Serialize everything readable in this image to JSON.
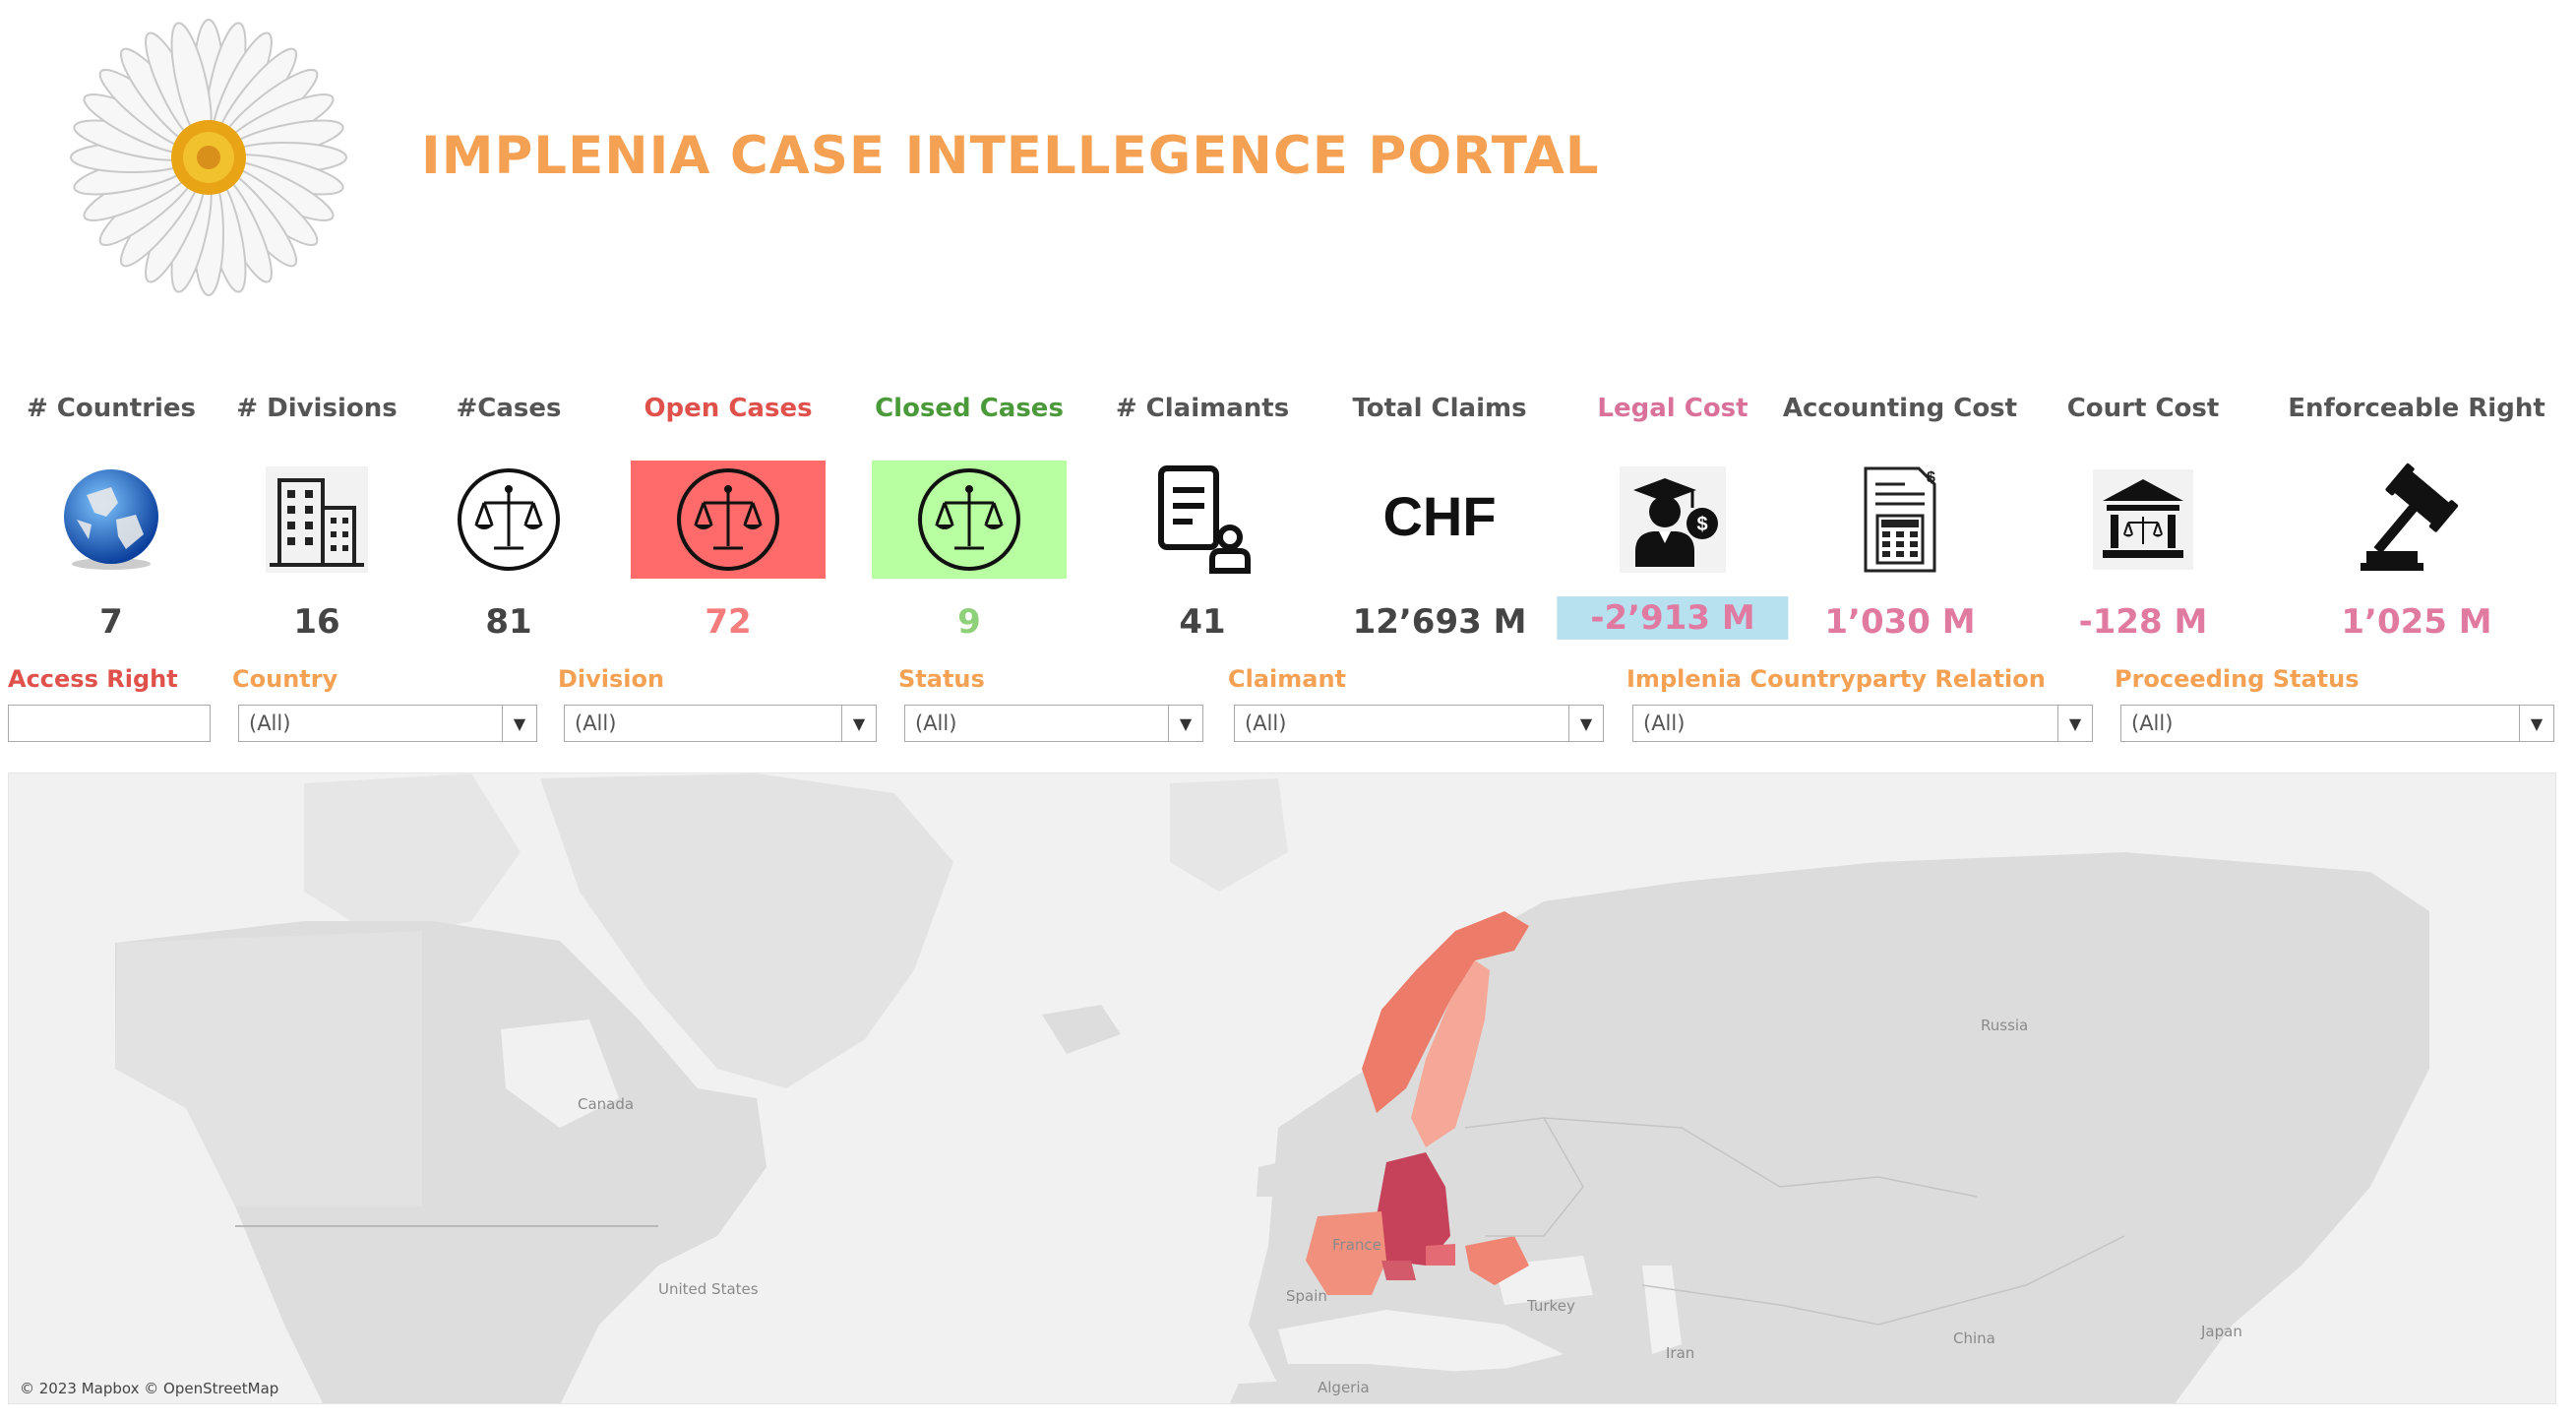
{
  "header": {
    "title": "IMPLENIA CASE INTELLEGENCE PORTAL",
    "logo_icon": "daisy-flower-icon"
  },
  "kpis": [
    {
      "label": "# Countries",
      "value": "7",
      "icon": "globe-icon",
      "label_color": "#555555",
      "value_color": "#444444"
    },
    {
      "label": "# Divisions",
      "value": "16",
      "icon": "building-icon",
      "label_color": "#555555",
      "value_color": "#444444"
    },
    {
      "label": "#Cases",
      "value": "81",
      "icon": "scales-icon",
      "label_color": "#555555",
      "value_color": "#444444"
    },
    {
      "label": "Open Cases",
      "value": "72",
      "icon": "scales-icon",
      "label_color": "#e0514b",
      "value_color": "#f47c7c",
      "background": "#ff6b6b"
    },
    {
      "label": "Closed Cases",
      "value": "9",
      "icon": "scales-icon",
      "label_color": "#4a9a3a",
      "value_color": "#8fd17a",
      "background": "#b7ffa0"
    },
    {
      "label": "# Claimants",
      "value": "41",
      "icon": "document-user-icon",
      "label_color": "#555555",
      "value_color": "#444444"
    },
    {
      "label": "Total Claims",
      "value": "12’693 M",
      "icon_text": "CHF",
      "icon": "chf-currency-icon",
      "label_color": "#555555",
      "value_color": "#444444"
    },
    {
      "label": "Legal Cost",
      "value": "-2’913 M",
      "icon": "lawyer-graduate-icon",
      "label_color": "#d9719a",
      "value_color": "#e07aa0",
      "value_background": "#b8e1f0"
    },
    {
      "label": "Accounting Cost",
      "value": "1’030 M",
      "icon": "invoice-calculator-icon",
      "label_color": "#555555",
      "value_color": "#e07aa0"
    },
    {
      "label": "Court Cost",
      "value": "-128 M",
      "icon": "courthouse-icon",
      "label_color": "#555555",
      "value_color": "#e07aa0"
    },
    {
      "label": "Enforceable Right",
      "value": "1’025 M",
      "icon": "gavel-icon",
      "label_color": "#555555",
      "value_color": "#e07aa0"
    }
  ],
  "filters": [
    {
      "label": "Access Right",
      "value": "",
      "label_color": "#e0514b",
      "type": "text"
    },
    {
      "label": "Country",
      "value": "(All)",
      "label_color": "#f4a154",
      "type": "select"
    },
    {
      "label": "Division",
      "value": "(All)",
      "label_color": "#f4a154",
      "type": "select"
    },
    {
      "label": "Status",
      "value": "(All)",
      "label_color": "#f4a154",
      "type": "select"
    },
    {
      "label": "Claimant",
      "value": "(All)",
      "label_color": "#f4a154",
      "type": "select"
    },
    {
      "label": "Implenia Countryparty Relation",
      "value": "(All)",
      "label_color": "#f4a154",
      "type": "select"
    },
    {
      "label": "Proceeding Status",
      "value": "(All)",
      "label_color": "#f4a154",
      "type": "select"
    }
  ],
  "map": {
    "labels": [
      "Canada",
      "United States",
      "Russia",
      "Turkey",
      "Spain",
      "Iran",
      "China",
      "Japan",
      "Algeria",
      "France"
    ],
    "attribution": "© 2023 Mapbox © OpenStreetMap",
    "colors": {
      "land": "#dcdcdc",
      "water": "#f1f1f1",
      "low": "#f5a898",
      "mid": "#ec7b6a",
      "high": "#c6425a"
    }
  }
}
